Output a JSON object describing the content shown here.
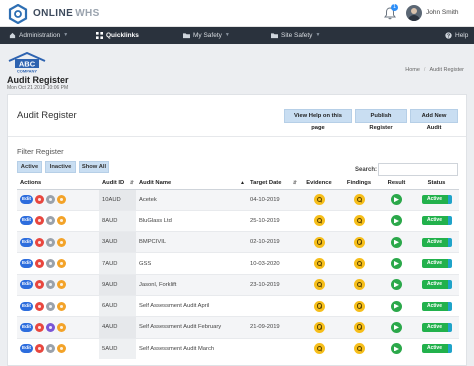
{
  "brand": {
    "name": "ONLINE",
    "suffix": "WHS"
  },
  "topbar": {
    "notification_count": "1",
    "user_name": "John Smith"
  },
  "nav": [
    {
      "label": "Administration",
      "icon": "home-icon"
    },
    {
      "label": "Quicklinks",
      "icon": "grid-icon"
    },
    {
      "label": "My Safety",
      "icon": "folder-icon"
    },
    {
      "label": "Site Safety",
      "icon": "folder-icon"
    }
  ],
  "help_label": "Help",
  "page": {
    "logo_top": "ABC",
    "logo_bottom": "COMPANY",
    "title": "Audit Register",
    "date": "Mon Oct 21 2019 10:06 PM",
    "breadcrumb": [
      "Home",
      "Audit Register"
    ]
  },
  "panel": {
    "title": "Audit Register",
    "buttons": [
      "View Help on this page",
      "Publish Register",
      "Add New Audit"
    ],
    "filter_title": "Filter Register",
    "filters": [
      "Active",
      "Inactive",
      "Show All"
    ],
    "search_label": "Search:",
    "search_value": ""
  },
  "table": {
    "columns": [
      "Actions",
      "Audit ID",
      "Audit Name",
      "Target Date",
      "Evidence",
      "Findings",
      "Result",
      "Status"
    ],
    "edit_label": "Edit",
    "rows": [
      {
        "id": "10AUD",
        "name": "Acetek",
        "date": "04-10-2019",
        "status": "Active",
        "third_icon": "grey"
      },
      {
        "id": "8AUD",
        "name": "BluGlass Ltd",
        "date": "25-10-2019",
        "status": "Active",
        "third_icon": "grey"
      },
      {
        "id": "3AUD",
        "name": "BMPCIVIL",
        "date": "02-10-2019",
        "status": "Active",
        "third_icon": "grey"
      },
      {
        "id": "7AUD",
        "name": "GSS",
        "date": "10-03-2020",
        "status": "Active",
        "third_icon": "grey"
      },
      {
        "id": "9AUD",
        "name": "Jasonl, Forklift",
        "date": "23-10-2019",
        "status": "Active",
        "third_icon": "grey"
      },
      {
        "id": "6AUD",
        "name": "Self Assessment Audit April",
        "date": "",
        "status": "Active",
        "third_icon": "grey"
      },
      {
        "id": "4AUD",
        "name": "Self Assessment Audit February",
        "date": "21-09-2019",
        "status": "Active",
        "third_icon": "purple"
      },
      {
        "id": "5AUD",
        "name": "Self Assessment Audit March",
        "date": "",
        "status": "Active",
        "third_icon": "grey"
      }
    ]
  },
  "colors": {
    "nav_bg": "#2a323d",
    "button_bg": "#c9def2",
    "edit_blue": "#2d6ddd",
    "active_green": "#22b14c",
    "status_bar": "#1fa3c9"
  }
}
